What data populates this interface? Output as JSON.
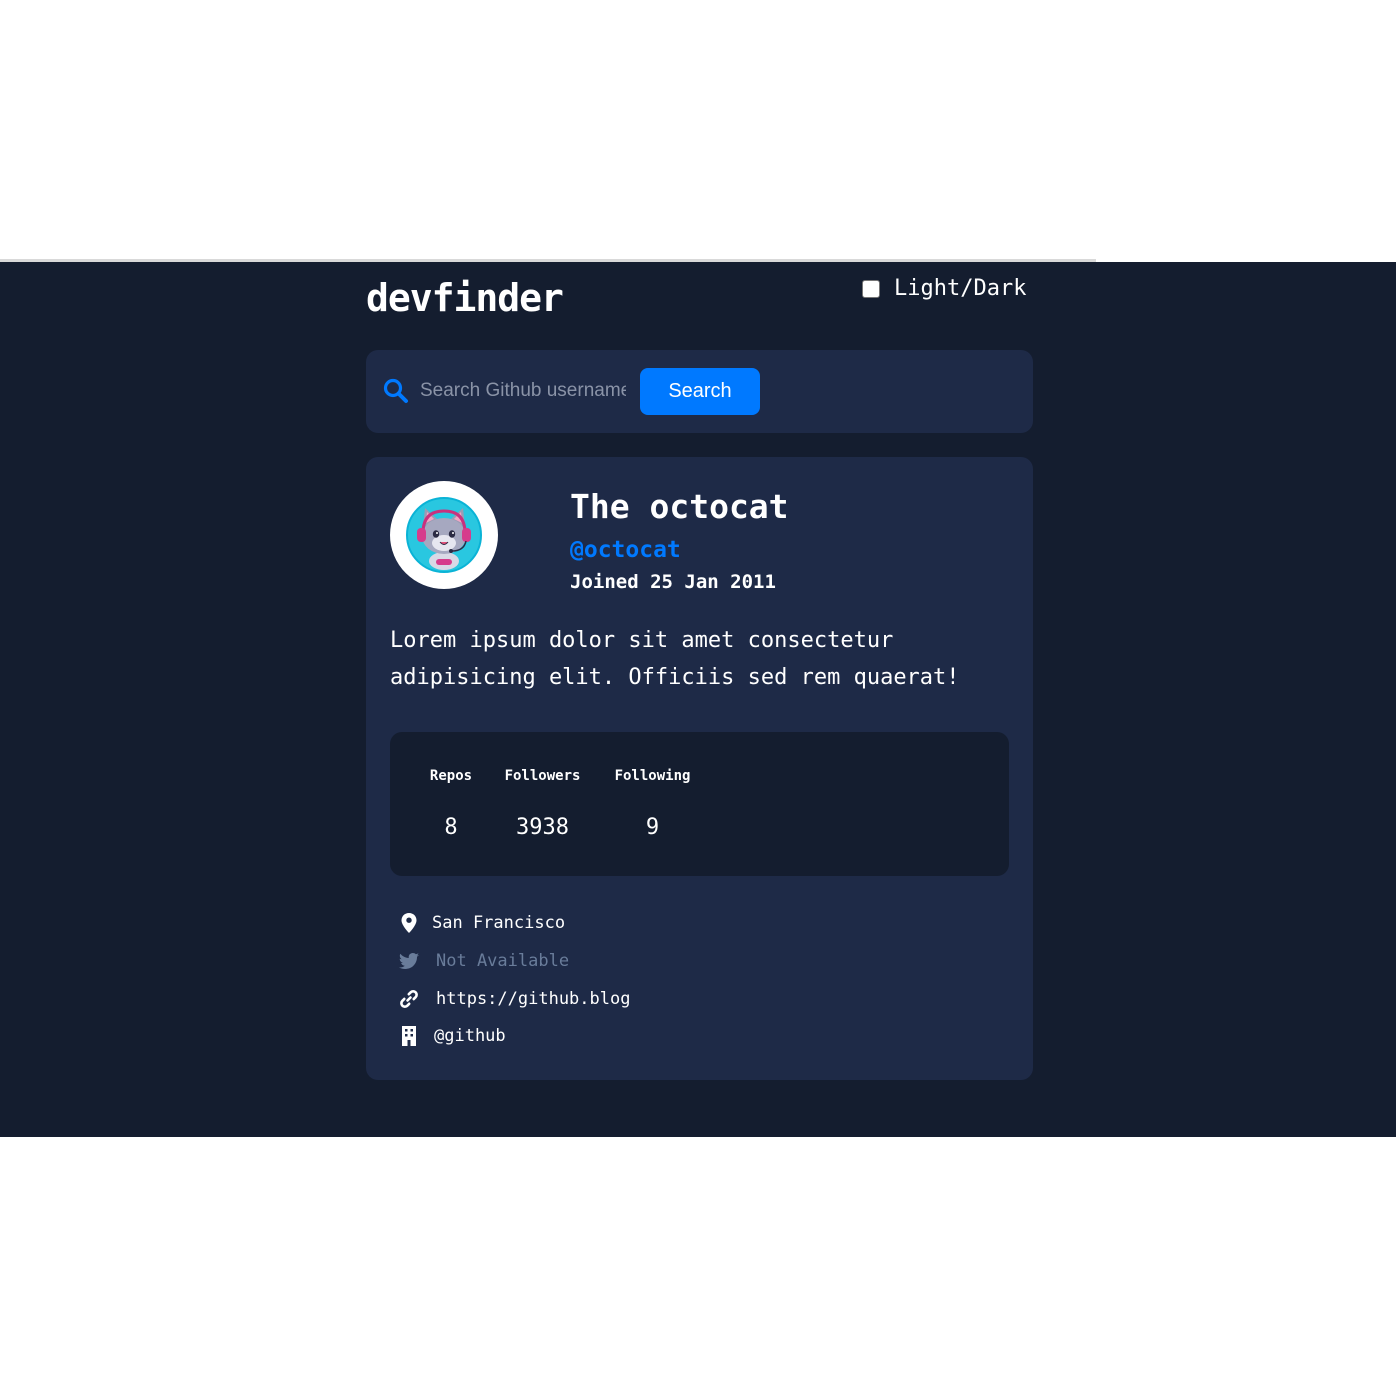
{
  "app": {
    "logo": "devfinder",
    "theme_toggle_label": "Light/Dark"
  },
  "search": {
    "placeholder": "Search Github username...",
    "button_label": "Search"
  },
  "profile": {
    "name": "The octocat",
    "handle": "@octocat",
    "joined": "Joined 25 Jan 2011",
    "bio_line1": "Lorem ipsum dolor sit amet consectetur",
    "bio_line2": "adipisicing elit. Officiis sed rem quaerat!"
  },
  "stats": {
    "repos_label": "Repos",
    "repos_value": "8",
    "followers_label": "Followers",
    "followers_value": "3938",
    "following_label": "Following",
    "following_value": "9"
  },
  "links": {
    "location": "San Francisco",
    "twitter": "Not Available",
    "website": "https://github.blog",
    "company": "@github"
  },
  "colors": {
    "page_bg": "#141d2f",
    "card_bg": "#1e2a47",
    "accent": "#0079ff",
    "muted": "#697c9a",
    "text": "#ffffff"
  }
}
